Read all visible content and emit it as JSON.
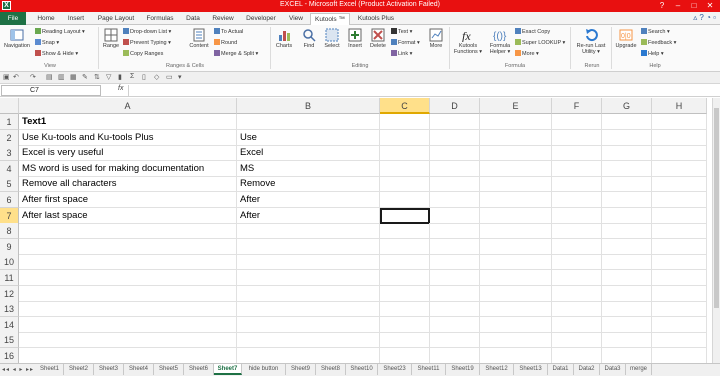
{
  "window": {
    "title": "EXCEL - Microsoft Excel (Product Activation Failed)",
    "buttons": [
      "?",
      "–",
      "□",
      "✕"
    ]
  },
  "tabs": [
    {
      "label": "File",
      "type": "file"
    },
    {
      "label": "Home"
    },
    {
      "label": "Insert"
    },
    {
      "label": "Page Layout"
    },
    {
      "label": "Formulas"
    },
    {
      "label": "Data"
    },
    {
      "label": "Review"
    },
    {
      "label": "Developer"
    },
    {
      "label": "View"
    },
    {
      "label": "Kutools ™",
      "active": true
    },
    {
      "label": "Kutools Plus"
    }
  ],
  "ribbon": {
    "view_group": {
      "navigation": "Navigation",
      "reading_layout": "Reading Layout ▾",
      "snap": "Snap ▾",
      "show_hide": "Show & Hide ▾",
      "label": "View"
    },
    "ranges_group": {
      "range": "Range",
      "drop_down_list": "Drop-down List ▾",
      "prevent_typing": "Prevent Typing ▾",
      "copy_ranges": "Copy Ranges",
      "content": "Content",
      "to_actual": "To Actual",
      "round": "Round",
      "merge_split": "Merge & Split ▾",
      "label": "Ranges & Cells"
    },
    "editing_group": {
      "charts": "Charts",
      "find": "Find",
      "select": "Select",
      "insert": "Insert",
      "delete": "Delete",
      "text": "Text ▾",
      "format": "Format ▾",
      "link": "Link ▾",
      "more": "More",
      "label": "Editing"
    },
    "formula_group": {
      "kutools_functions": "Kutools Functions ▾",
      "formula_helper": "Formula Helper ▾",
      "exact_copy": "Exact Copy",
      "super_lookup": "Super LOOKUP ▾",
      "more": "More ▾",
      "label": "Formula"
    },
    "rerun_group": {
      "rerun": "Re-run Last Utility ▾",
      "label": "Rerun"
    },
    "help_group": {
      "upgrade": "Upgrade",
      "search": "Search ▾",
      "feedback": "Feedback ▾",
      "help": "Help ▾",
      "label": "Help"
    }
  },
  "formula_bar": {
    "name_box": "C7",
    "fx": "fx",
    "formula": ""
  },
  "columns": [
    "A",
    "B",
    "C",
    "D",
    "E",
    "F",
    "G",
    "H"
  ],
  "selected_column": "C",
  "selected_row": "7",
  "rows": [
    {
      "num": "1",
      "a": "Text1",
      "b": "",
      "bold": true
    },
    {
      "num": "2",
      "a": "Use Ku-tools and Ku-tools Plus",
      "b": "Use"
    },
    {
      "num": "3",
      "a": "Excel is very useful",
      "b": "Excel"
    },
    {
      "num": "4",
      "a": "MS word is used for making documentation",
      "b": "MS"
    },
    {
      "num": "5",
      "a": "Remove all characters",
      "b": "Remove"
    },
    {
      "num": "6",
      "a": "After first space",
      "b": "After"
    },
    {
      "num": "7",
      "a": "After last space",
      "b": "After"
    },
    {
      "num": "8",
      "a": "",
      "b": ""
    },
    {
      "num": "9",
      "a": "",
      "b": ""
    },
    {
      "num": "10",
      "a": "",
      "b": ""
    },
    {
      "num": "11",
      "a": "",
      "b": ""
    },
    {
      "num": "12",
      "a": "",
      "b": ""
    },
    {
      "num": "13",
      "a": "",
      "b": ""
    },
    {
      "num": "14",
      "a": "",
      "b": ""
    },
    {
      "num": "15",
      "a": "",
      "b": ""
    },
    {
      "num": "16",
      "a": "",
      "b": ""
    }
  ],
  "sheets": [
    "Sheet1",
    "Sheet2",
    "Sheet3",
    "Sheet4",
    "Sheet5",
    "Sheet6",
    "Sheet7",
    "hide button",
    "Sheet9",
    "Sheet8",
    "Sheet10",
    "Sheet23",
    "Sheet11",
    "Sheet19",
    "Sheet12",
    "Sheet13",
    "Data1",
    "Data2",
    "Data3",
    "merge"
  ],
  "active_sheet": "Sheet7",
  "sheet_nav": "◂◂ ◂ ▸ ▸▸"
}
